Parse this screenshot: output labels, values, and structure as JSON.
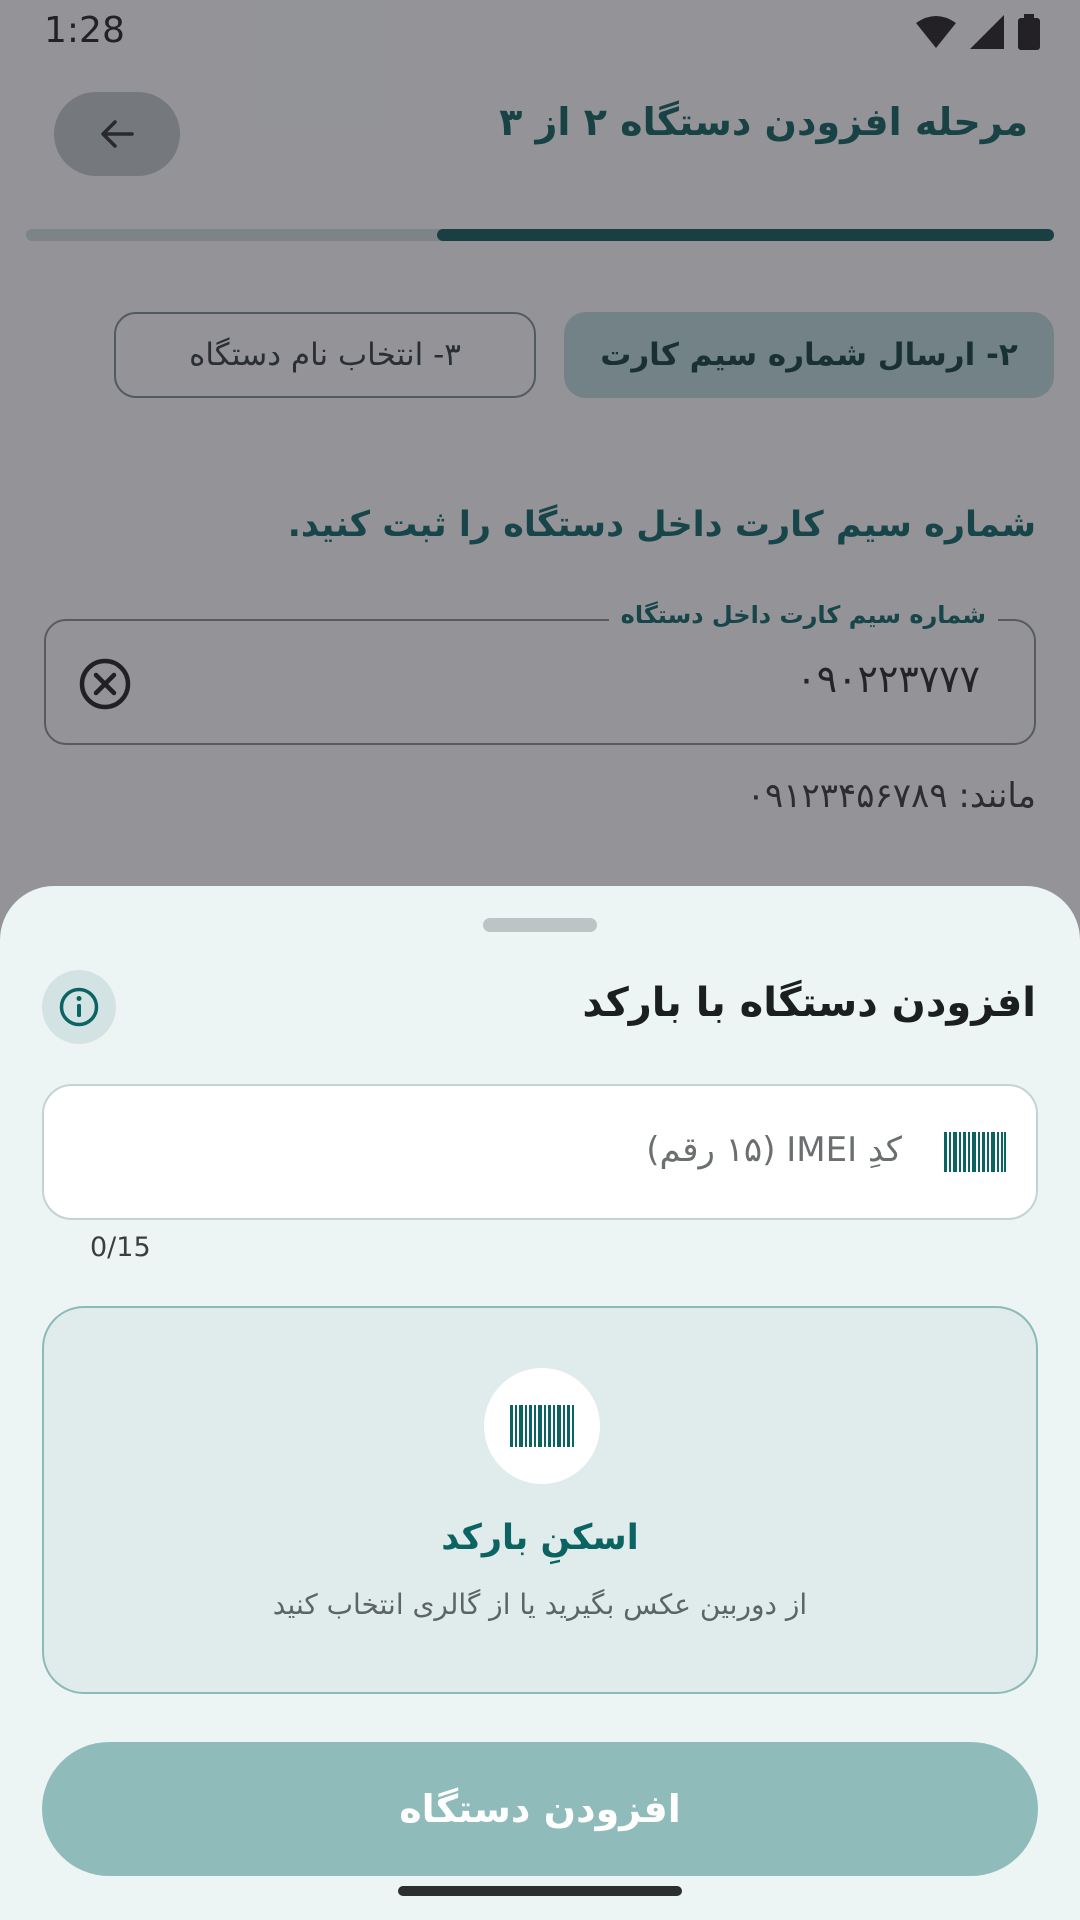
{
  "status_bar": {
    "time": "1:28"
  },
  "header": {
    "title": "مرحله افزودن دستگاه ۲ از ۳"
  },
  "progress": {
    "fraction": 0.6
  },
  "steps": {
    "active": "۲- ارسال شماره سیم کارت",
    "next": "۳- انتخاب نام دستگاه"
  },
  "form": {
    "instruction": "شماره سیم کارت داخل دستگاه را ثبت کنید.",
    "sim_label": "شماره سیم کارت داخل دستگاه",
    "sim_value": "۰۹۰۲۲۳۷۷۷",
    "example": "مانند: ۰۹۱۲۳۴۵۶۷۸۹"
  },
  "sheet": {
    "title": "افزودن دستگاه با بارکد",
    "imei_placeholder": "کدِ IMEI (۱۵ رقم)",
    "counter": "0/15",
    "scan_title": "اسکنِ بارکد",
    "scan_subtitle": "از دوربین عکس بگیرید یا از گالری انتخاب کنید",
    "add_button": "افزودن دستگاه"
  },
  "colors": {
    "primary": "#0b6362",
    "progress_fill": "#0e5857",
    "button_disabled": "#8fbcba",
    "sheet_bg": "#edf4f4"
  },
  "icons": {
    "back": "arrow-left-icon",
    "clear": "close-circle-icon",
    "info": "info-icon",
    "barcode": "barcode-icon",
    "wifi": "wifi-icon",
    "signal": "signal-icon",
    "battery": "battery-icon"
  }
}
